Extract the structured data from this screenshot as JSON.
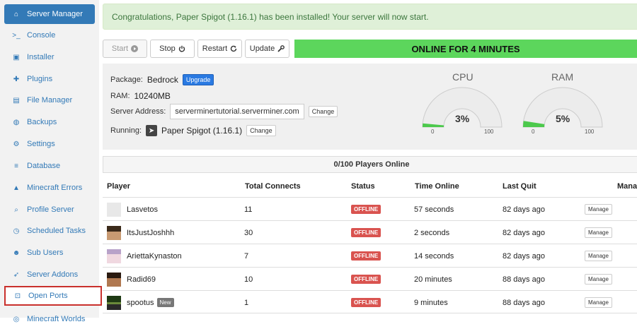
{
  "sidebar": {
    "items": [
      {
        "label": "Server Manager",
        "icon": "home-icon",
        "glyph": "⌂"
      },
      {
        "label": "Console",
        "icon": "terminal-icon",
        "glyph": ">_"
      },
      {
        "label": "Installer",
        "icon": "cubes-icon",
        "glyph": "▣"
      },
      {
        "label": "Plugins",
        "icon": "puzzle-icon",
        "glyph": "✚"
      },
      {
        "label": "File Manager",
        "icon": "file-icon",
        "glyph": "▤"
      },
      {
        "label": "Backups",
        "icon": "globe-icon",
        "glyph": "◍"
      },
      {
        "label": "Settings",
        "icon": "gear-icon",
        "glyph": "⚙"
      },
      {
        "label": "Database",
        "icon": "database-icon",
        "glyph": "≡"
      },
      {
        "label": "Minecraft Errors",
        "icon": "warning-icon",
        "glyph": "▲"
      },
      {
        "label": "Profile Server",
        "icon": "search-icon",
        "glyph": "⌕"
      },
      {
        "label": "Scheduled Tasks",
        "icon": "clock-icon",
        "glyph": "◷"
      },
      {
        "label": "Sub Users",
        "icon": "users-icon",
        "glyph": "☻"
      },
      {
        "label": "Server Addons",
        "icon": "rocket-icon",
        "glyph": "➶"
      },
      {
        "label": "Open Ports",
        "icon": "unlock-icon",
        "glyph": "⊡"
      },
      {
        "label": "Minecraft Worlds",
        "icon": "world-icon",
        "glyph": "◎"
      }
    ]
  },
  "alert": {
    "text": "Congratulations, Paper Spigot (1.16.1) has been installed! Your server will now start."
  },
  "toolbar": {
    "start_label": "Start",
    "stop_label": "Stop",
    "restart_label": "Restart",
    "update_label": "Update",
    "status_text": "ONLINE FOR 4 MINUTES",
    "status_color": "#5cd65c"
  },
  "info": {
    "package_label": "Package:",
    "package_value": "Bedrock",
    "upgrade_label": "Upgrade",
    "ram_label": "RAM:",
    "ram_value": "10240MB",
    "address_label": "Server Address:",
    "address_value": "serverminertutorial.serverminer.com",
    "change_label": "Change",
    "running_label": "Running:",
    "running_value": "Paper Spigot (1.16.1)",
    "running_change_label": "Change"
  },
  "gauges": [
    {
      "title": "CPU",
      "value": 3,
      "value_text": "3%",
      "min": "0",
      "max": "100"
    },
    {
      "title": "RAM",
      "value": 5,
      "value_text": "5%",
      "min": "0",
      "max": "100"
    }
  ],
  "players": {
    "header": "0/100 Players Online",
    "columns": [
      "Player",
      "Total Connects",
      "Status",
      "Time Online",
      "Last Quit",
      "Manage"
    ],
    "rows": [
      {
        "name": "Lasvetos",
        "connects": "11",
        "status": "OFFLINE",
        "time_online": "57 seconds",
        "last_quit": "82 days ago",
        "manage": "Manage",
        "new": ""
      },
      {
        "name": "ItsJustJoshhh",
        "connects": "30",
        "status": "OFFLINE",
        "time_online": "2 seconds",
        "last_quit": "82 days ago",
        "manage": "Manage",
        "new": ""
      },
      {
        "name": "AriettaKynaston",
        "connects": "7",
        "status": "OFFLINE",
        "time_online": "14 seconds",
        "last_quit": "82 days ago",
        "manage": "Manage",
        "new": ""
      },
      {
        "name": "Radid69",
        "connects": "10",
        "status": "OFFLINE",
        "time_online": "20 minutes",
        "last_quit": "88 days ago",
        "manage": "Manage",
        "new": ""
      },
      {
        "name": "spootus",
        "connects": "1",
        "status": "OFFLINE",
        "time_online": "9 minutes",
        "last_quit": "88 days ago",
        "manage": "Manage",
        "new": "New"
      }
    ]
  }
}
